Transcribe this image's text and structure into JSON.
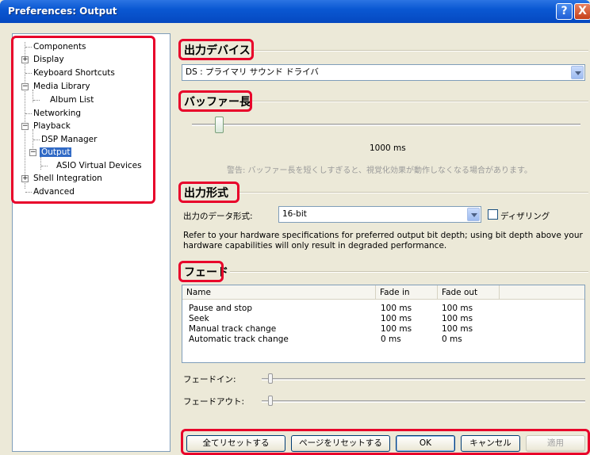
{
  "window": {
    "title": "Preferences: Output",
    "help_glyph": "?",
    "close_glyph": "X"
  },
  "tree": {
    "items": [
      {
        "label": "Components"
      },
      {
        "label": "Display",
        "expander": "+"
      },
      {
        "label": "Keyboard Shortcuts"
      },
      {
        "label": "Media Library",
        "expander": "−"
      },
      {
        "label": "Album List"
      },
      {
        "label": "Networking"
      },
      {
        "label": "Playback",
        "expander": "−"
      },
      {
        "label": "DSP Manager"
      },
      {
        "label": "Output",
        "expander": "−",
        "selected": true
      },
      {
        "label": "ASIO Virtual Devices"
      },
      {
        "label": "Shell Integration",
        "expander": "+"
      },
      {
        "label": "Advanced"
      }
    ]
  },
  "device": {
    "heading": "出力デバイス",
    "selected": "DS : プライマリ サウンド ドライバ"
  },
  "buffer": {
    "heading": "バッファー長",
    "value_label": "1000 ms",
    "level": 0.04,
    "warning": "警告: バッファー長を短くしすぎると、視覚化効果が動作しなくなる場合があります。"
  },
  "format": {
    "heading": "出力形式",
    "field_label": "出力のデータ形式:",
    "selected": "16-bit",
    "dither_label": "ディザリング",
    "dither_checked": false,
    "note_line1": "Refer to your hardware specifications for preferred output bit depth; using bit depth above your",
    "note_line2": "hardware capabilities will only result in degraded performance."
  },
  "fade": {
    "heading": "フェード",
    "columns": [
      "Name",
      "Fade in",
      "Fade out"
    ],
    "rows": [
      {
        "name": "Pause and stop",
        "fade_in": "100 ms",
        "fade_out": "100 ms"
      },
      {
        "name": "Seek",
        "fade_in": "100 ms",
        "fade_out": "100 ms"
      },
      {
        "name": "Manual track change",
        "fade_in": "100 ms",
        "fade_out": "100 ms"
      },
      {
        "name": "Automatic track change",
        "fade_in": "0 ms",
        "fade_out": "0 ms"
      }
    ],
    "fade_in_label": "フェードイン:",
    "fade_out_label": "フェードアウト:",
    "fade_in_level": 0.02,
    "fade_out_level": 0.02
  },
  "buttons": {
    "reset_all": "全てリセットする",
    "reset_page": "ページをリセットする",
    "ok": "OK",
    "cancel": "キャンセル",
    "apply": "適用"
  },
  "colors": {
    "highlight_box": "#e8002a",
    "selection": "#316ac5",
    "titlebar": "#0a58d2"
  }
}
